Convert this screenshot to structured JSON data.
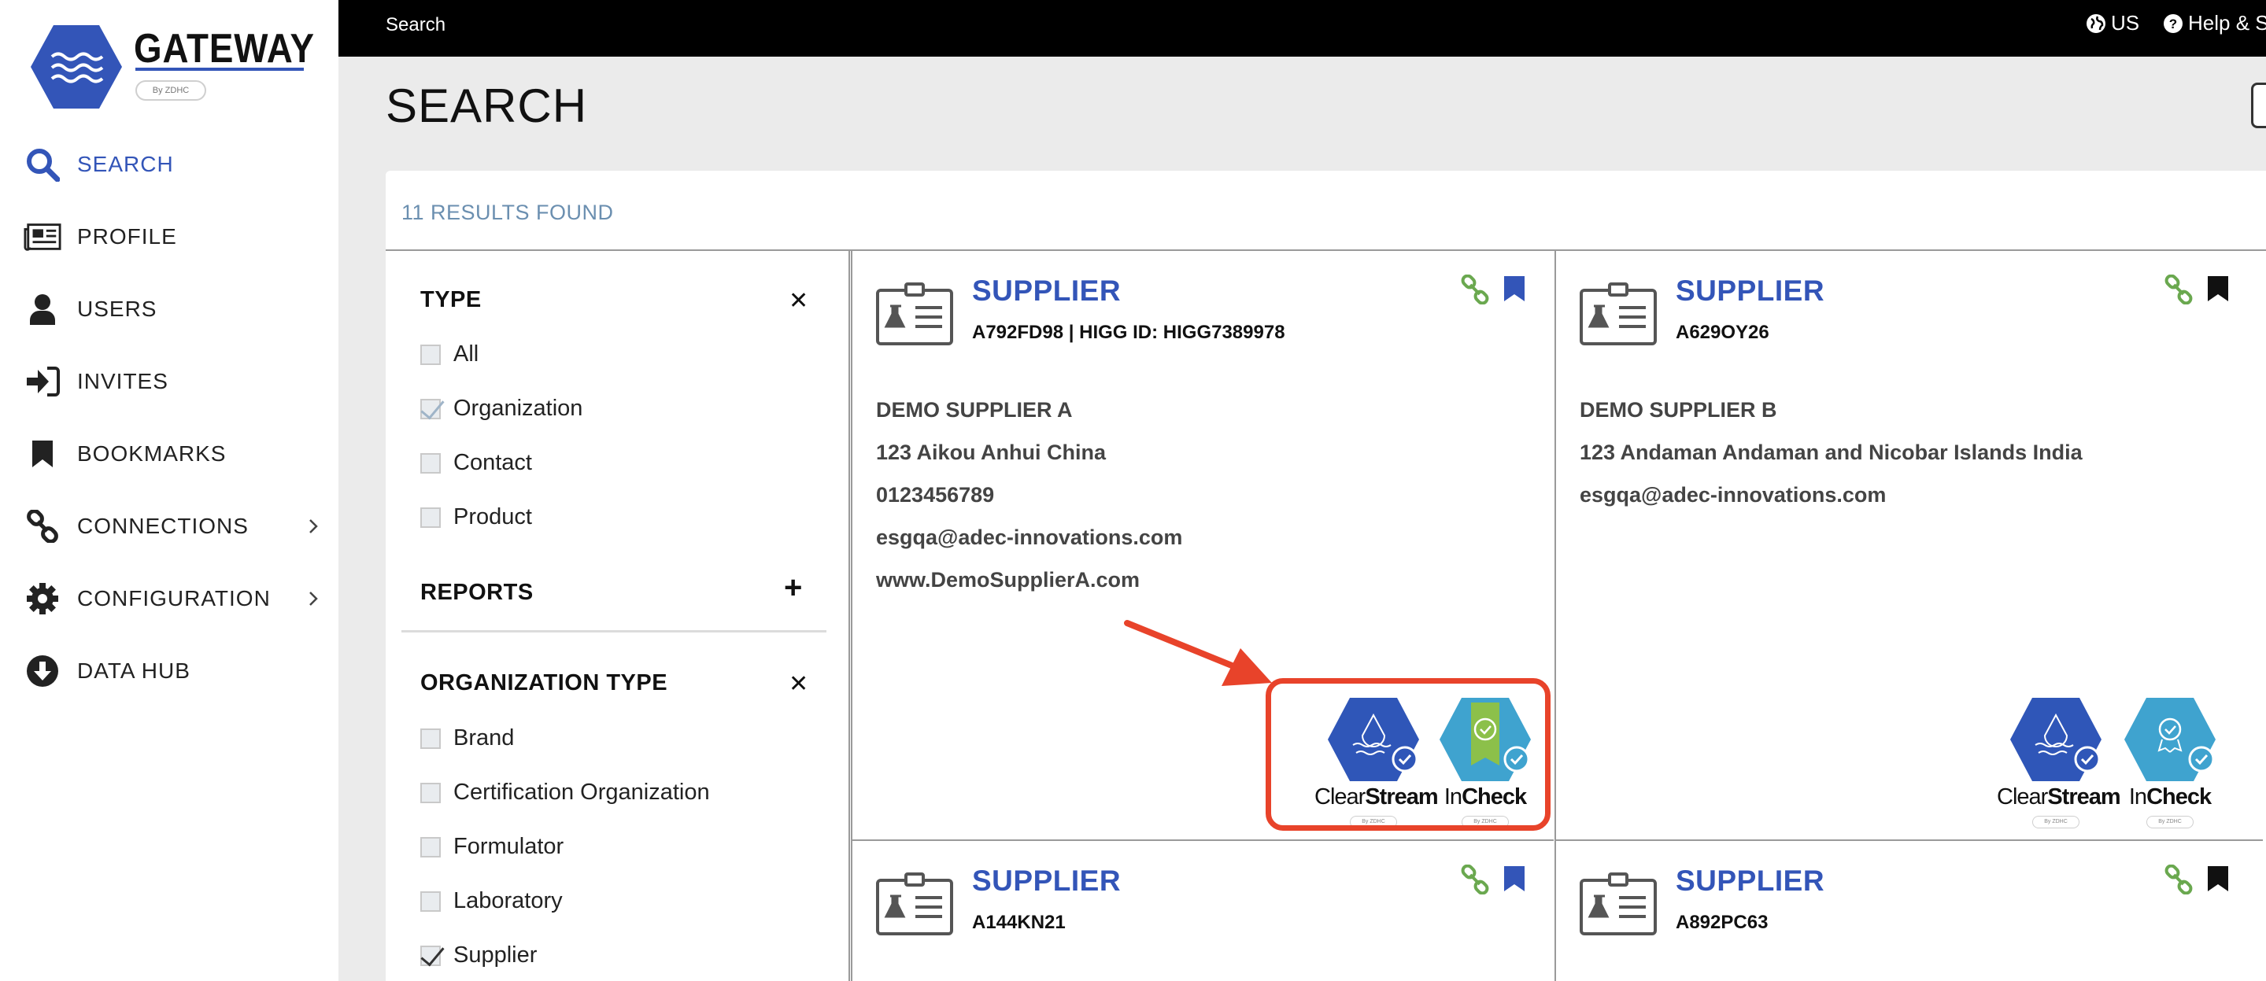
{
  "app": {
    "title": "GATEWAY",
    "by_label": "By ZDHC"
  },
  "sidebar": {
    "items": [
      {
        "label": "SEARCH",
        "icon": "search-icon",
        "active": true
      },
      {
        "label": "PROFILE",
        "icon": "newspaper-icon"
      },
      {
        "label": "USERS",
        "icon": "user-icon"
      },
      {
        "label": "INVITES",
        "icon": "sign-in-icon"
      },
      {
        "label": "BOOKMARKS",
        "icon": "bookmark-icon"
      },
      {
        "label": "CONNECTIONS",
        "icon": "link-icon",
        "expandable": true
      },
      {
        "label": "CONFIGURATION",
        "icon": "gear-icon",
        "expandable": true
      },
      {
        "label": "DATA HUB",
        "icon": "download-circle-icon"
      }
    ]
  },
  "topbar": {
    "breadcrumb": "Search",
    "language": "US",
    "help": "Help & S"
  },
  "page": {
    "title": "SEARCH",
    "results_found": "11 RESULTS FOUND"
  },
  "filters": {
    "type": {
      "heading": "TYPE",
      "options": [
        {
          "label": "All",
          "checked": false
        },
        {
          "label": "Organization",
          "checked": true
        },
        {
          "label": "Contact",
          "checked": false
        },
        {
          "label": "Product",
          "checked": false
        }
      ]
    },
    "reports": {
      "heading": "REPORTS"
    },
    "organization_type": {
      "heading": "ORGANIZATION TYPE",
      "options": [
        {
          "label": "Brand",
          "checked": false
        },
        {
          "label": "Certification Organization",
          "checked": false
        },
        {
          "label": "Formulator",
          "checked": false
        },
        {
          "label": "Laboratory",
          "checked": false
        },
        {
          "label": "Supplier",
          "checked": true
        }
      ]
    }
  },
  "cards": [
    {
      "type": "SUPPLIER",
      "id_line": "A792FD98 | HIGG ID: HIGG7389978",
      "name": "DEMO SUPPLIER A",
      "address": "123 Aikou Anhui China",
      "phone": "0123456789",
      "email": "esgqa@adec-innovations.com",
      "website": "www.DemoSupplierA.com",
      "bookmarked": true,
      "certs": [
        {
          "light": "Clear",
          "bold": "Stream",
          "sub": "By ZDHC"
        },
        {
          "light": "In",
          "bold": "Check",
          "sub": "By ZDHC"
        }
      ]
    },
    {
      "type": "SUPPLIER",
      "id_line": "A629OY26",
      "name": "DEMO SUPPLIER B",
      "address": "123 Andaman Andaman and Nicobar Islands India",
      "email": "esgqa@adec-innovations.com",
      "bookmarked": true,
      "certs": [
        {
          "light": "Clear",
          "bold": "Stream",
          "sub": "By ZDHC"
        },
        {
          "light": "In",
          "bold": "Check",
          "sub": "By ZDHC"
        }
      ]
    },
    {
      "type": "SUPPLIER",
      "id_line": "A144KN21",
      "bookmarked": true
    },
    {
      "type": "SUPPLIER",
      "id_line": "A892PC63",
      "bookmarked": true
    }
  ],
  "colors": {
    "accent": "#3355b8",
    "link_green": "#6aa84f",
    "annotation": "#e8432a",
    "clearstream": "#2f56b8",
    "incheck": "#3fa3cf"
  }
}
